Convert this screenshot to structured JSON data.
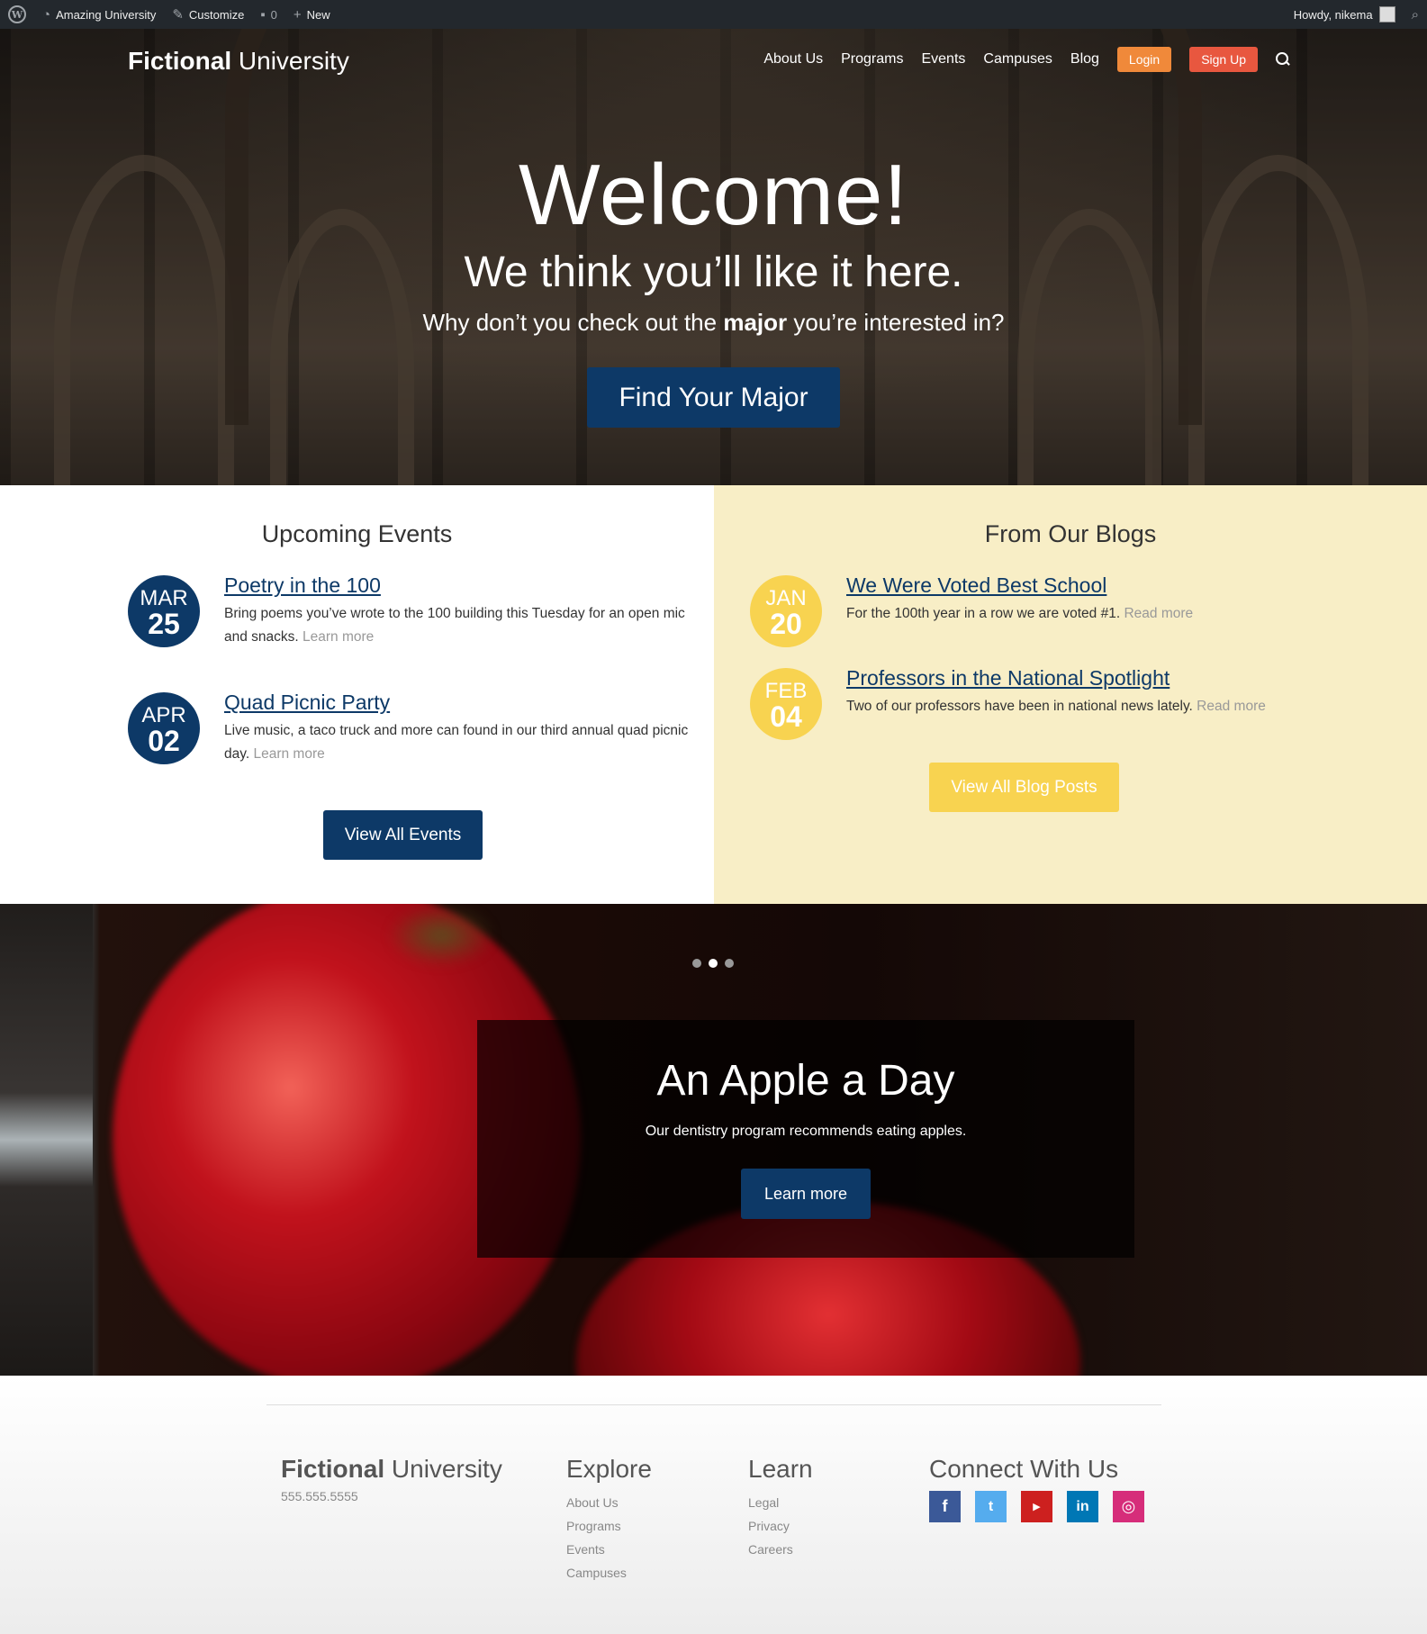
{
  "admin_bar": {
    "site_name": "Amazing University",
    "customize": "Customize",
    "comments_count": "0",
    "new": "New",
    "howdy": "Howdy, nikema"
  },
  "header": {
    "logo_bold": "Fictional",
    "logo_rest": "University",
    "nav": [
      "About Us",
      "Programs",
      "Events",
      "Campuses",
      "Blog"
    ],
    "login": "Login",
    "signup": "Sign Up"
  },
  "hero": {
    "title": "Welcome!",
    "subtitle": "We think you’ll like it here.",
    "line_before": "Why don’t you check out the",
    "line_bold": "major",
    "line_after": "you’re interested in?",
    "button": "Find Your Major"
  },
  "events": {
    "title": "Upcoming Events",
    "items": [
      {
        "month": "MAR",
        "day": "25",
        "title": "Poetry in the 100",
        "text": "Bring poems you’ve wrote to the 100 building this Tuesday for an open mic and snacks.",
        "more": "Learn more"
      },
      {
        "month": "APR",
        "day": "02",
        "title": "Quad Picnic Party",
        "text": "Live music, a taco truck and more can found in our third annual quad picnic day.",
        "more": "Learn more"
      }
    ],
    "button": "View All Events"
  },
  "blogs": {
    "title": "From Our Blogs",
    "items": [
      {
        "month": "JAN",
        "day": "20",
        "title": "We Were Voted Best School",
        "text": "For the 100th year in a row we are voted #1.",
        "more": "Read more"
      },
      {
        "month": "FEB",
        "day": "04",
        "title": "Professors in the National Spotlight",
        "text": "Two of our professors have been in national news lately.",
        "more": "Read more"
      }
    ],
    "button": "View All Blog Posts"
  },
  "slider": {
    "active_dot": 2,
    "dot_count": 3,
    "title": "An Apple a Day",
    "text": "Our dentistry program recommends eating apples.",
    "button": "Learn more"
  },
  "footer": {
    "logo_bold": "Fictional",
    "logo_rest": "University",
    "phone": "555.555.5555",
    "explore_title": "Explore",
    "explore": [
      "About Us",
      "Programs",
      "Events",
      "Campuses"
    ],
    "learn_title": "Learn",
    "learn": [
      "Legal",
      "Privacy",
      "Careers"
    ],
    "connect_title": "Connect With Us",
    "social_icons": [
      "facebook-icon",
      "twitter-icon",
      "youtube-icon",
      "linkedin-icon",
      "instagram-icon"
    ]
  },
  "colors": {
    "primary_blue": "#0d3967",
    "blog_yellow": "#f8d350",
    "blog_bg": "#f8eec6",
    "login_orange": "#f0893a",
    "signup_red": "#e8573f"
  }
}
